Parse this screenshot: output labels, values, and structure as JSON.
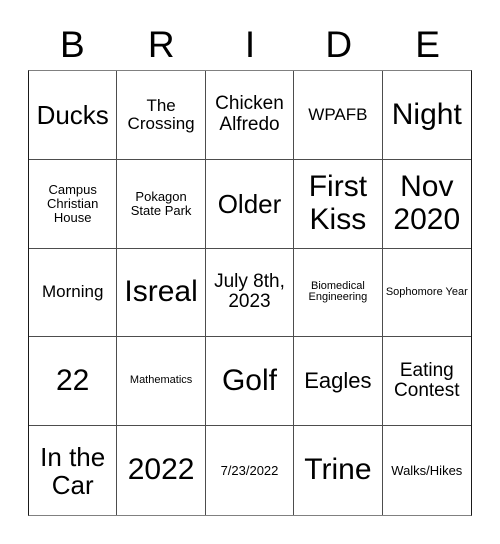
{
  "card": {
    "title_letters": [
      "B",
      "R",
      "I",
      "D",
      "E"
    ],
    "columns": 5,
    "rows": 5,
    "border_color": "#4d4d4d",
    "background_color": "#ffffff",
    "text_color": "#000000",
    "cells": [
      {
        "text": "Ducks",
        "size": "fs-xl"
      },
      {
        "text": "The Crossing",
        "size": "fs-sm"
      },
      {
        "text": "Chicken Alfredo",
        "size": "fs-md"
      },
      {
        "text": "WPAFB",
        "size": "fs-sm"
      },
      {
        "text": "Night",
        "size": "fs-xxl"
      },
      {
        "text": "Campus Christian House",
        "size": "fs-xs"
      },
      {
        "text": "Pokagon State Park",
        "size": "fs-xs"
      },
      {
        "text": "Older",
        "size": "fs-xl"
      },
      {
        "text": "First Kiss",
        "size": "fs-xxl"
      },
      {
        "text": "Nov 2020",
        "size": "fs-xxl"
      },
      {
        "text": "Morning",
        "size": "fs-sm"
      },
      {
        "text": "Isreal",
        "size": "fs-xxl"
      },
      {
        "text": "July 8th, 2023",
        "size": "fs-md"
      },
      {
        "text": "Biomedical Engineering",
        "size": "fs-xxs"
      },
      {
        "text": "Sophomore Year",
        "size": "fs-xxs"
      },
      {
        "text": "22",
        "size": "fs-xxl"
      },
      {
        "text": "Mathematics",
        "size": "fs-xxs"
      },
      {
        "text": "Golf",
        "size": "fs-xxl"
      },
      {
        "text": "Eagles",
        "size": "fs-lg"
      },
      {
        "text": "Eating Contest",
        "size": "fs-md"
      },
      {
        "text": "In the Car",
        "size": "fs-xl"
      },
      {
        "text": "2022",
        "size": "fs-xxl"
      },
      {
        "text": "7/23/2022",
        "size": "fs-xs"
      },
      {
        "text": "Trine",
        "size": "fs-xxl"
      },
      {
        "text": "Walks/Hikes",
        "size": "fs-xs"
      }
    ]
  }
}
